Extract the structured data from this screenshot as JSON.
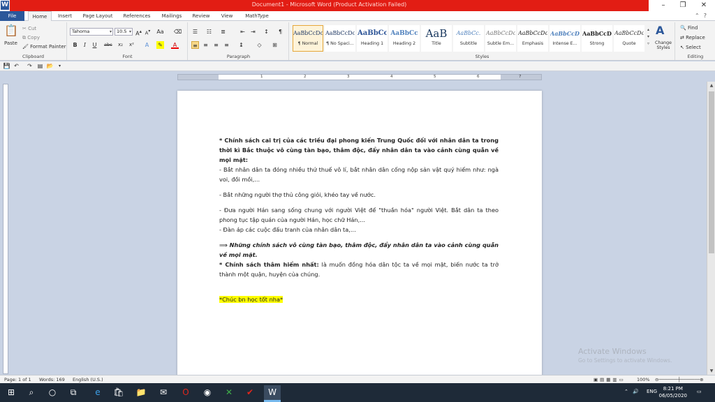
{
  "window": {
    "title": "Document1  -  Microsoft Word (Product Activation Failed)",
    "app_icon": "W",
    "controls": [
      "–",
      "❐",
      "✕"
    ]
  },
  "tabs": [
    "File",
    "Home",
    "Insert",
    "Page Layout",
    "References",
    "Mailings",
    "Review",
    "View",
    "MathType"
  ],
  "ribbon": {
    "clipboard": {
      "paste": "Paste",
      "cut": "Cut",
      "copy": "Copy",
      "format_painter": "Format Painter",
      "label": "Clipboard"
    },
    "font": {
      "font_name": "Tahoma",
      "font_size": "10.5",
      "label": "Font"
    },
    "paragraph": {
      "label": "Paragraph"
    },
    "styles": {
      "label": "Styles",
      "items": [
        {
          "sample": "AaBbCcDc",
          "name": "¶ Normal"
        },
        {
          "sample": "AaBbCcDc",
          "name": "¶ No Spaci..."
        },
        {
          "sample": "AaBbCc",
          "name": "Heading 1"
        },
        {
          "sample": "AaBbCc",
          "name": "Heading 2"
        },
        {
          "sample": "AaB",
          "name": "Title"
        },
        {
          "sample": "AaBbCc.",
          "name": "Subtitle"
        },
        {
          "sample": "AaBbCcDc",
          "name": "Subtle Em..."
        },
        {
          "sample": "AaBbCcDc",
          "name": "Emphasis"
        },
        {
          "sample": "AaBbCcDc",
          "name": "Intense E..."
        },
        {
          "sample": "AaBbCcDc",
          "name": "Strong"
        },
        {
          "sample": "AaBbCcDc",
          "name": "Quote"
        }
      ],
      "change_styles": "Change Styles"
    },
    "editing": {
      "find": "Find",
      "replace": "Replace",
      "select": "Select",
      "label": "Editing"
    }
  },
  "document": {
    "p1_bold": "* Chính sách cai trị của các triều đại phong kiến Trung Quốc đối với nhân dân ta trong thời kì Bắc thuộc vô cùng tàn bạo, thâm độc, đẩy nhân dân ta vào cảnh cùng quẫn về mọi mặt:",
    "p1_b": "- Bắt nhân dân ta đóng nhiều thứ thuế vô lí, bắt nhân dân cống nộp sản vật quý hiếm như: ngà voi, đồi mồi,...",
    "p2": "- Bắt những người thợ thủ công giỏi, khéo tay về nước.",
    "p3": "- Đưa người Hán sang sống chung với người Việt để \"thuần hóa\" người Việt. Bắt dân ta theo phong tục tập quán của người Hán, học chữ Hán,...",
    "p4": "- Đàn áp các cuộc đấu tranh của nhân dân ta,...",
    "p5": "⟹ Những chính sách vô cùng tàn bạo, thâm độc, đẩy nhân dân ta vào cảnh cùng quẫn về mọi mặt.",
    "p6_lead": "* Chính sách thâm hiểm nhất:",
    "p6_rest": " là muốn đồng hóa dân tộc ta về mọi mặt, biến nước ta trở thành một quận, huyện của chúng.",
    "p7": "*Chúc bn học tốt nha*"
  },
  "watermark": {
    "line1": "Activate Windows",
    "line2": "Go to Settings to activate Windows."
  },
  "status": {
    "page": "Page: 1 of 1",
    "words": "Words: 169",
    "language": "English (U.S.)",
    "zoom": "100%"
  },
  "taskbar": {
    "time": "8:21 PM",
    "date": "06/05/2020",
    "lang": "ENG"
  },
  "colors": {
    "title_red": "#e21d14",
    "word_blue": "#2b579a",
    "highlight": "#ffff00"
  }
}
